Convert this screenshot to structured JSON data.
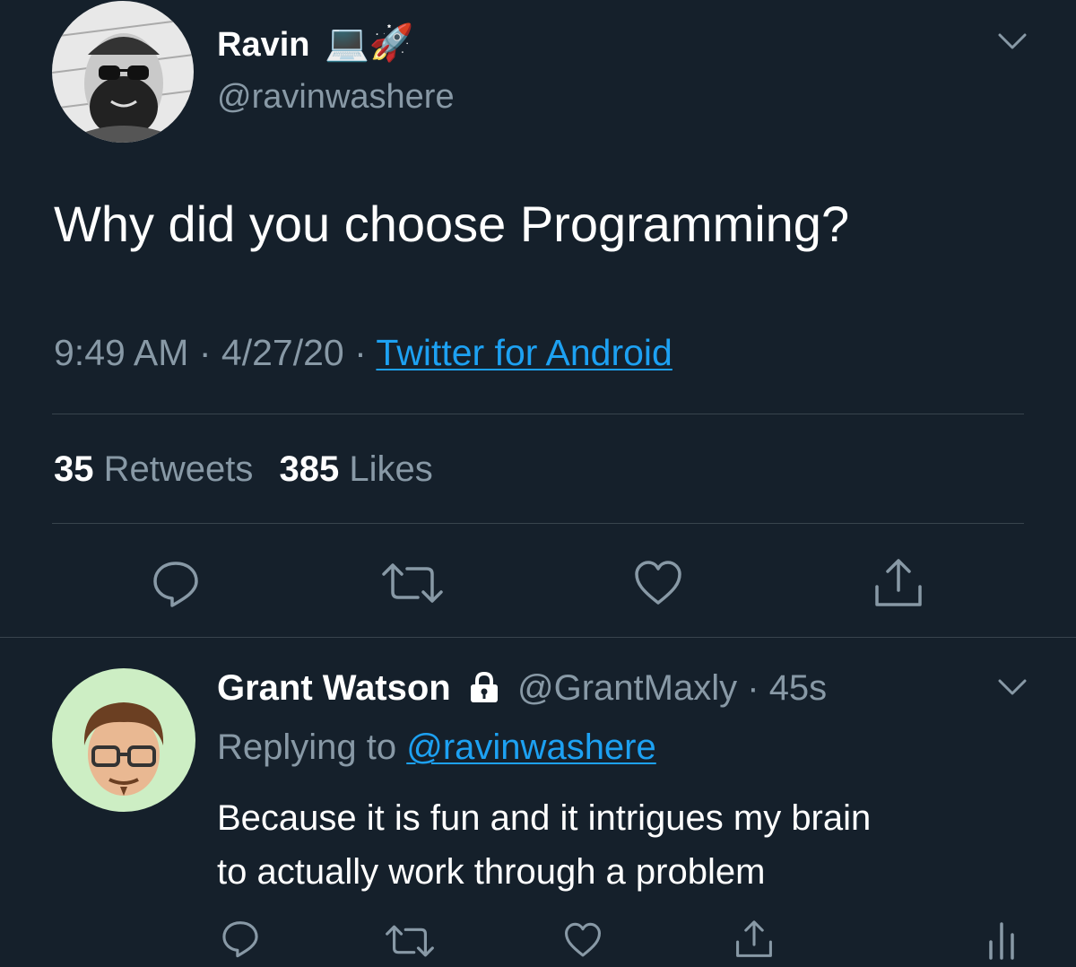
{
  "main_tweet": {
    "author_name": "Ravin",
    "author_emojis": "💻🚀",
    "handle": "@ravinwashere",
    "text": "Why did you choose Programming?",
    "time": "9:49 AM",
    "sep1": "·",
    "date": "4/27/20",
    "sep2": "·",
    "source": "Twitter for Android",
    "retweet_count": "35",
    "retweets_label": "Retweets",
    "like_count": "385",
    "likes_label": "Likes"
  },
  "reply": {
    "author_name": "Grant Watson",
    "handle": "@GrantMaxly",
    "sep": "·",
    "age": "45s",
    "replying_label": "Replying to",
    "replying_handle": "@ravinwashere",
    "text_line1": "Because it is fun and it intrigues my brain",
    "text_line2": "to actually work through a problem"
  },
  "colors": {
    "background": "#15202b",
    "text_primary": "#ffffff",
    "text_secondary": "#8899a6",
    "link": "#1da1f2",
    "divider": "#38444d"
  },
  "icons": [
    "reply-icon",
    "retweet-icon",
    "like-icon",
    "share-icon",
    "chevron-down-icon",
    "lock-icon",
    "analytics-icon"
  ]
}
